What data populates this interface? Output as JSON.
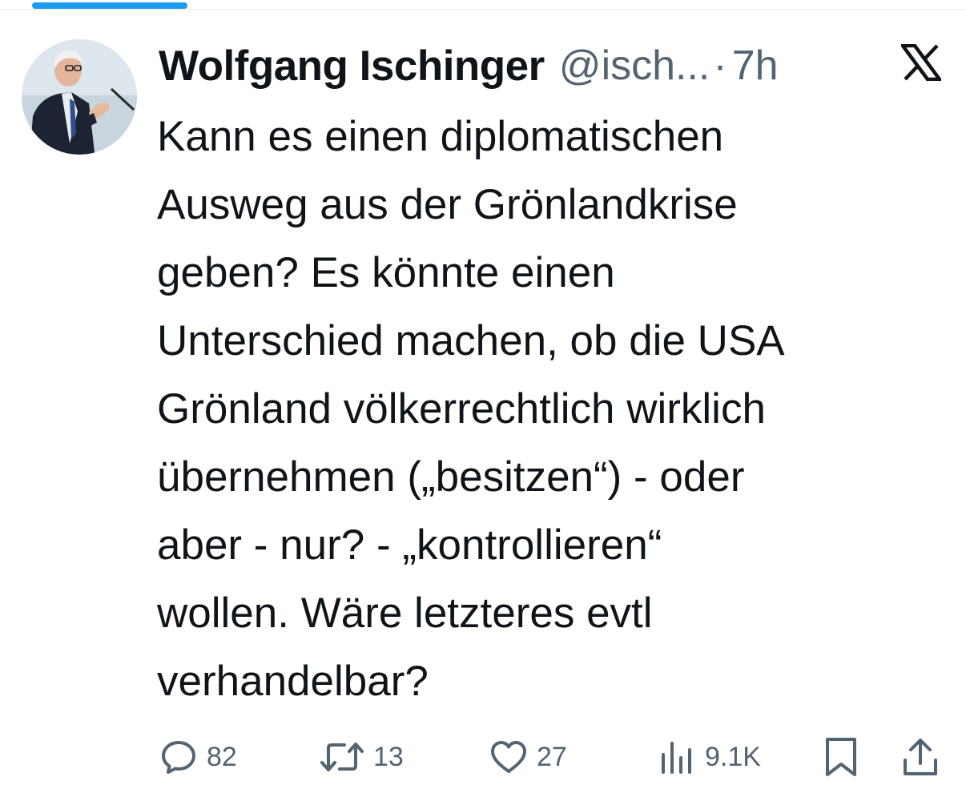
{
  "tweet": {
    "author": {
      "name": "Wolfgang Ischinger",
      "handle": "@isch...",
      "separator": "·",
      "time": "7h"
    },
    "text_lines": [
      "Kann es einen diplomatischen",
      "Ausweg aus der Grönlandkrise",
      "geben? Es könnte einen",
      "Unterschied machen, ob die USA",
      "Grönland völkerrechtlich wirklich",
      "übernehmen („besitzen“) - oder",
      "aber - nur? - „kontrollieren“",
      "wollen. Wäre letzteres evtl",
      "verhandelbar?"
    ],
    "metrics": {
      "replies": "82",
      "reposts": "13",
      "likes": "27",
      "views": "9.1K"
    }
  },
  "icons": {
    "platform": "x-logo-icon",
    "reply": "reply-icon",
    "repost": "repost-icon",
    "like": "heart-icon",
    "views": "views-icon",
    "bookmark": "bookmark-icon",
    "share": "share-icon"
  },
  "colors": {
    "text": "#0f1419",
    "secondary": "#536471",
    "accent": "#1d9bf0"
  }
}
